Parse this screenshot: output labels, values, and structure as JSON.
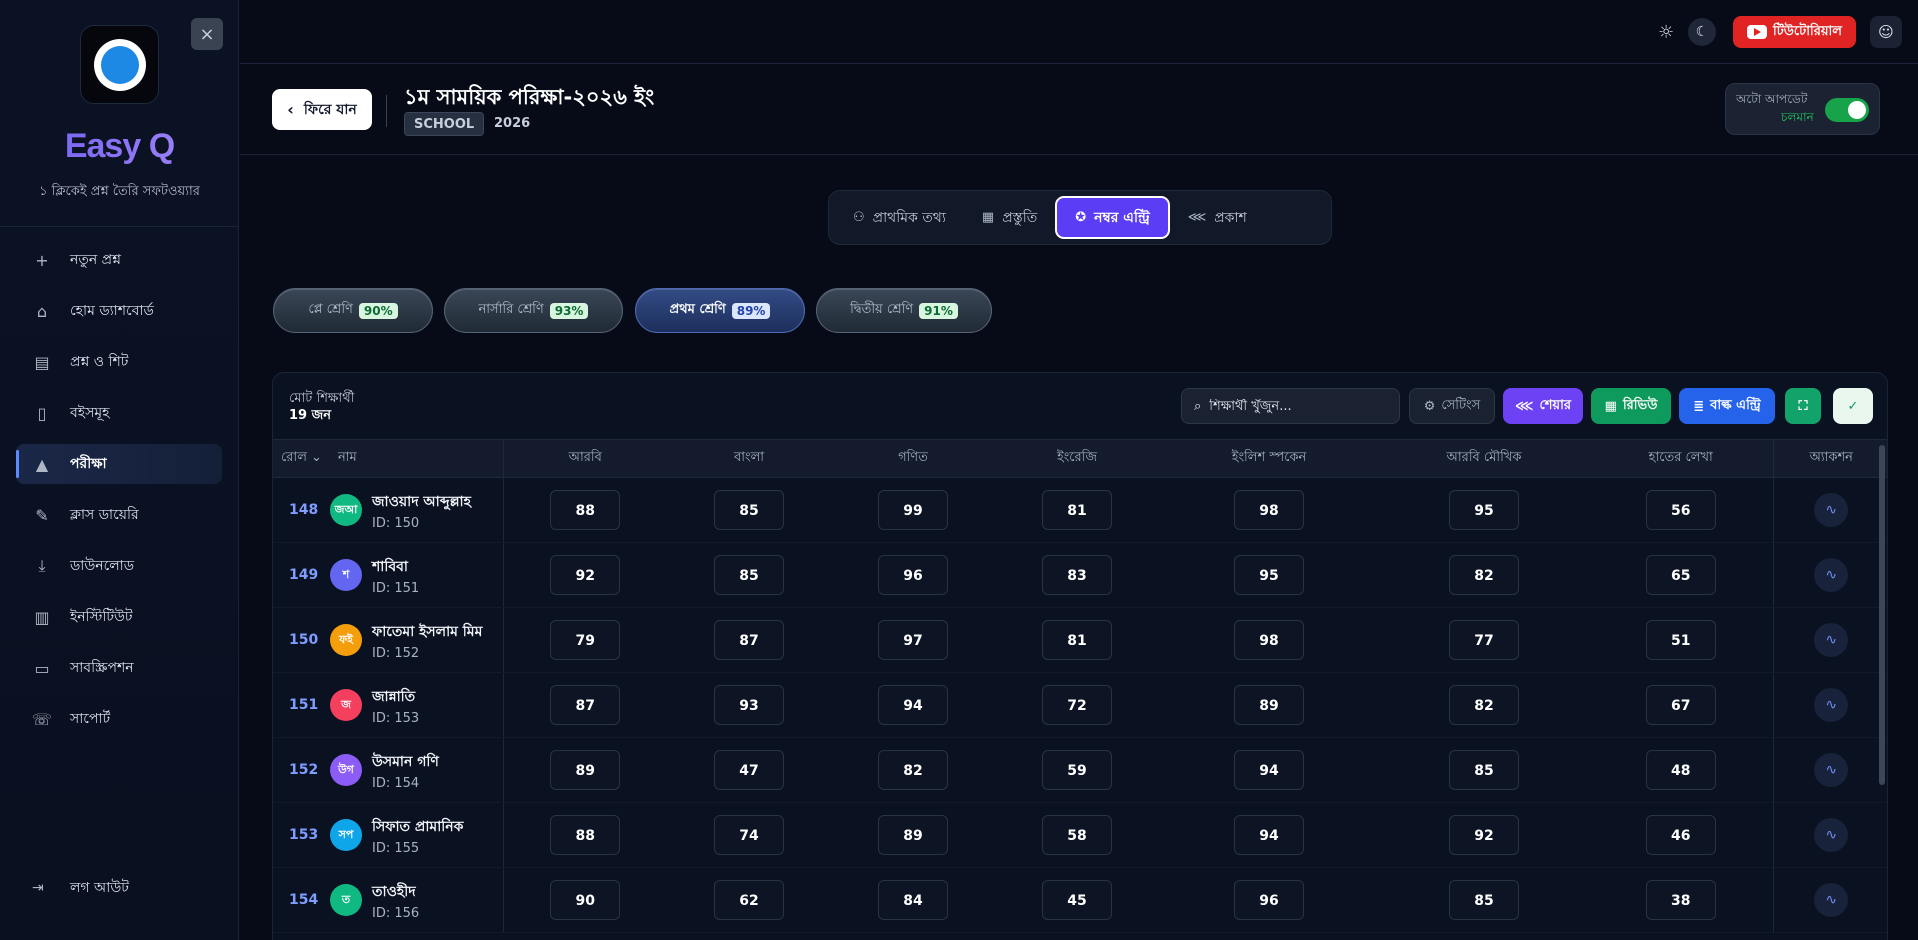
{
  "sidebar": {
    "brand": "Easy Q",
    "tagline": "১ ক্লিকেই প্রশ্ন তৈরি সফটওয়্যার",
    "items": [
      {
        "label": "নতুন প্রশ্ন",
        "icon": "plus-icon"
      },
      {
        "label": "হোম ড্যাশবোর্ড",
        "icon": "home-icon"
      },
      {
        "label": "প্রশ্ন ও শিট",
        "icon": "document-icon"
      },
      {
        "label": "বইসমূহ",
        "icon": "book-icon"
      },
      {
        "label": "পরীক্ষা",
        "icon": "graduation-cap-icon",
        "active": true
      },
      {
        "label": "ক্লাস ডায়েরি",
        "icon": "diary-icon"
      },
      {
        "label": "ডাউনলোড",
        "icon": "download-icon"
      },
      {
        "label": "ইনস্টিটিউট",
        "icon": "institute-icon"
      },
      {
        "label": "সাবস্ক্রিপশন",
        "icon": "credit-card-icon"
      },
      {
        "label": "সাপোর্ট",
        "icon": "phone-icon"
      }
    ],
    "logout": "লগ আউট"
  },
  "topbar": {
    "tutorial": "টিউটোরিয়াল"
  },
  "header": {
    "back": "ফিরে যান",
    "title": "১ম সাময়িক পরিক্ষা-২০২৬ ইং",
    "badge": "SCHOOL",
    "year": "2026",
    "auto_update_label": "অটো আপডেট",
    "auto_update_status": "চলমান"
  },
  "steps": [
    {
      "label": "প্রাথমিক তথ্য",
      "icon": "users-icon"
    },
    {
      "label": "প্রস্তুতি",
      "icon": "layout-icon"
    },
    {
      "label": "নম্বর এন্ট্রি",
      "icon": "award-icon",
      "active": true
    },
    {
      "label": "প্রকাশ",
      "icon": "share-icon"
    }
  ],
  "classes": [
    {
      "label": "প্লে শ্রেণি",
      "pct": "90%"
    },
    {
      "label": "নার্সারি শ্রেণি",
      "pct": "93%"
    },
    {
      "label": "প্রথম শ্রেণি",
      "pct": "89%",
      "active": true
    },
    {
      "label": "দ্বিতীয় শ্রেণি",
      "pct": "91%"
    }
  ],
  "table": {
    "total_label": "মোট শিক্ষার্থী",
    "total_count": "19 জন",
    "search_placeholder": "শিক্ষার্থী খুঁজুন...",
    "settings": "সেটিংস",
    "share": "শেয়ার",
    "review": "রিভিউ",
    "bulk": "বাল্ক এন্ট্রি",
    "headers": {
      "roll": "রোল",
      "name": "নাম",
      "subjects": [
        "আরবি",
        "বাংলা",
        "গণিত",
        "ইংরেজি",
        "ইংলিশ স্পকেন",
        "আরবি মৌখিক",
        "হাতের লেখা"
      ],
      "action": "অ্যাকশন"
    },
    "rows": [
      {
        "roll": "148",
        "avatar": "জআ",
        "color": "#10b981",
        "name": "জাওয়াদ আব্দুল্লাহ",
        "id": "ID: 150",
        "marks": [
          "88",
          "85",
          "99",
          "81",
          "98",
          "95",
          "56"
        ]
      },
      {
        "roll": "149",
        "avatar": "শ",
        "color": "#6366f1",
        "name": "শাবিবা",
        "id": "ID: 151",
        "marks": [
          "92",
          "85",
          "96",
          "83",
          "95",
          "82",
          "65"
        ]
      },
      {
        "roll": "150",
        "avatar": "ফই",
        "color": "#f59e0b",
        "name": "ফাতেমা ইসলাম মিম",
        "id": "ID: 152",
        "marks": [
          "79",
          "87",
          "97",
          "81",
          "98",
          "77",
          "51"
        ]
      },
      {
        "roll": "151",
        "avatar": "জ",
        "color": "#f43f5e",
        "name": "জান্নাতি",
        "id": "ID: 153",
        "marks": [
          "87",
          "93",
          "94",
          "72",
          "89",
          "82",
          "67"
        ]
      },
      {
        "roll": "152",
        "avatar": "উগ",
        "color": "#8b5cf6",
        "name": "উসমান গণি",
        "id": "ID: 154",
        "marks": [
          "89",
          "47",
          "82",
          "59",
          "94",
          "85",
          "48"
        ]
      },
      {
        "roll": "153",
        "avatar": "সপ",
        "color": "#0ea5e9",
        "name": "সিফাত প্রামানিক",
        "id": "ID: 155",
        "marks": [
          "88",
          "74",
          "89",
          "58",
          "94",
          "92",
          "46"
        ]
      },
      {
        "roll": "154",
        "avatar": "ত",
        "color": "#10b981",
        "name": "তাওহীদ",
        "id": "ID: 156",
        "marks": [
          "90",
          "62",
          "84",
          "45",
          "96",
          "85",
          "38"
        ]
      }
    ]
  }
}
